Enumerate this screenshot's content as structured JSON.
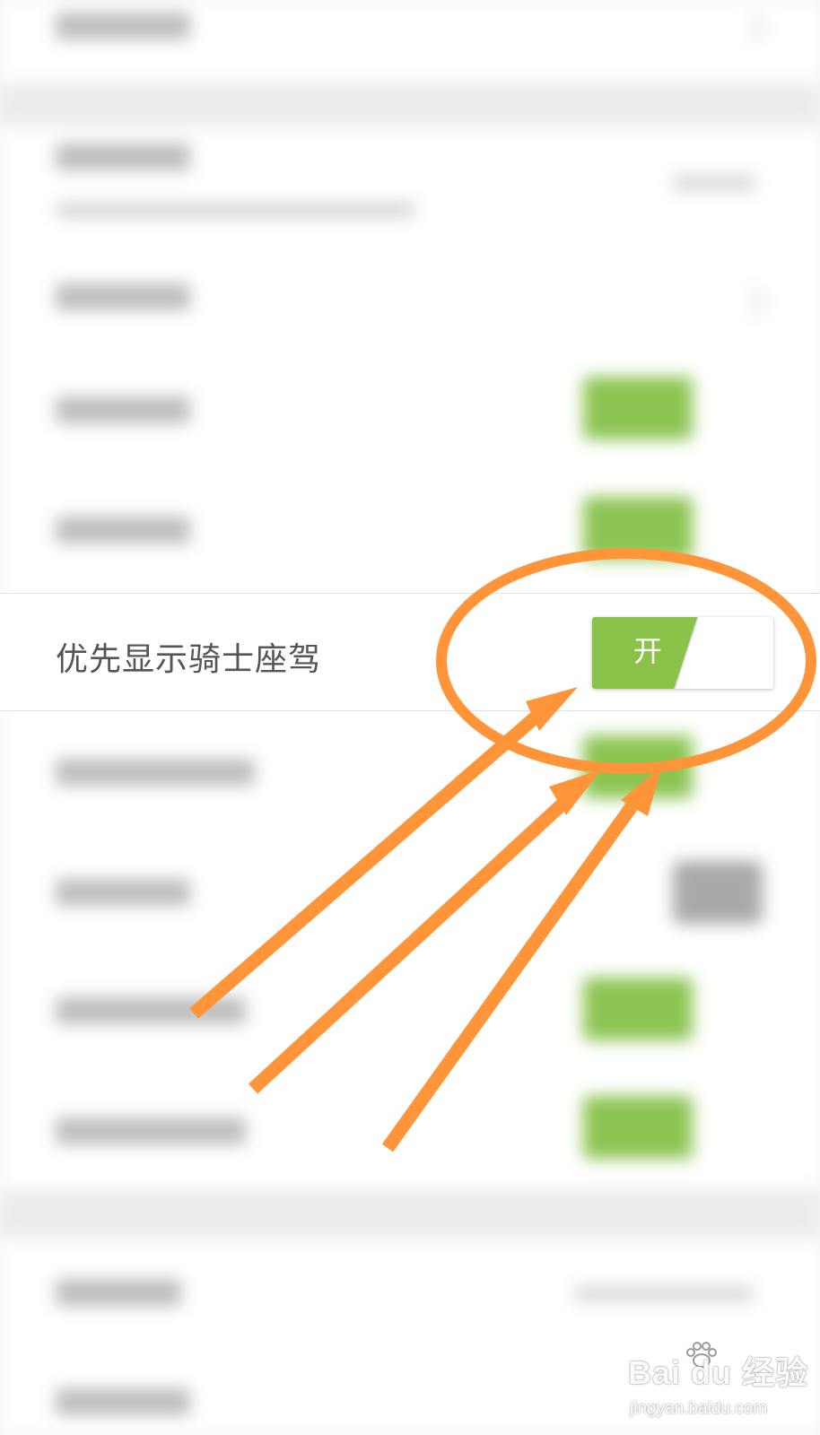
{
  "focused_setting": {
    "label": "优先显示骑士座驾",
    "toggle": {
      "state_label": "开",
      "is_on": true,
      "on_color": "#8bc34a"
    }
  },
  "annotation": {
    "color": "#ff9439",
    "icons": [
      "highlight-ellipse",
      "arrow-icon",
      "arrow-icon",
      "arrow-icon"
    ]
  },
  "watermark": {
    "brand": "Bai du 经验",
    "domain": "jingyan.baidu.com",
    "icon": "baidu-paw-icon"
  }
}
